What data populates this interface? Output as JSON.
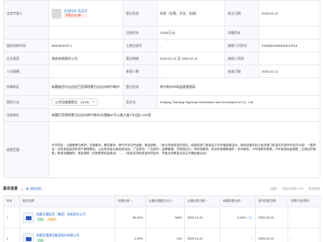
{
  "info": {
    "legal_rep_label": "法定代表人",
    "legal_rep_name": "艾克拉木·吾买尔",
    "legal_rep_badge": "关联企业4家",
    "registered_status_label": "登记状态",
    "registered_status_value": "存续（在营、开业、在册）",
    "established_date_label": "成立日期",
    "established_date_value": "2025-02-12",
    "registered_capital_label": "注册资本",
    "registered_capital_value": "10000万元",
    "paid_capital_label": "实缴资本",
    "paid_capital_value": "-",
    "org_code_label": "组织机构代码",
    "org_code_value": "MAEB1EUP-1",
    "reg_no_label": "工商注册号",
    "reg_no_value": "-",
    "credit_code_label": "纳税人识别号",
    "credit_code_value": "91652801MAEB1EUP18",
    "company_type_label": "企业类型",
    "company_type_value": "其他有限责任公司",
    "biz_term_label": "营业期限",
    "biz_term_value": "2025-02-12 至 2059-02-11",
    "taxpayer_qual_label": "纳税人资质",
    "taxpayer_qual_value": "-",
    "staff_label": "人员规模",
    "staff_value": "-",
    "insured_label": "参保人数",
    "insured_value": "-",
    "approved_date_label": "核准日期",
    "approved_date_value": "2025-02-12",
    "region_label": "所属地区",
    "region_value": "新疆维吾尔自治区巴音郭楞蒙古自治州库尔勒市",
    "authority_label": "登记机关",
    "authority_value": "库尔勒市市场监督管理局",
    "industry_label": "国标行业",
    "industry_value": "公共设施管理业",
    "industry_code": "(N78)",
    "en_name_label": "英文名",
    "en_name_value": "Xinjiang Tashang Highway Investment and Development Co., Ltd.",
    "address_label": "注册地址",
    "address_value": "新疆巴音郭楞蒙古自治州库尔勒市交通路80号公路大厦1号6层1-005室",
    "scope_label": "经营范围",
    "scope_value": "许可项目：公路管理与养护；住宿服务；餐饮服务；燃气汽车加气经营；食品销售。（依法须经批准的项目，经相关部门批准后方可开展经营活动，具体经营项目以相关部门批准文件或许可证件为准）一般项目：自有资金投资的资产管理服务；以自有资金从事投资活动；广告发布；广告制作；品牌管理；货物进出口；停车场服务；机动车修理和维护；洗车服务；汽车零配件零售；汽车装饰用品销售；日用百货销售；家用电器销售；食品销售（仅销售预包装食品）……（除依法须经批准的项目外，凭营业执照依法自主开展经营活动）"
  },
  "shareholders": {
    "title": "股东信息",
    "count": "2",
    "link_label": "股权结构",
    "tool_1": "仅显示持股>=5%",
    "tool_2": "导出数据",
    "columns": [
      "序号",
      "股东名称",
      "持股比例",
      "认缴出资额(万元)",
      "认缴出资日期",
      "间接持股比例",
      "首次持股日期",
      "关联产品/机构"
    ],
    "rows": [
      {
        "index": "1",
        "name": "新疆交通投资（集团）有限责任公司",
        "tag_1": "存续",
        "tag_2": "大股东",
        "ratio": "98.00%",
        "amount": "9800",
        "date": "2029-11-01",
        "indirect": "2.34%",
        "first_date": "2025-02-12",
        "product": "-"
      },
      {
        "index": "2",
        "name": "新疆交通建设集团股份有限公司",
        "tag_1": "存续",
        "tag_2": "",
        "ratio": "1.00%",
        "amount": "100",
        "date": "2029-11-01",
        "indirect": "-",
        "first_date": "2025-02-12",
        "product": "-"
      }
    ]
  }
}
